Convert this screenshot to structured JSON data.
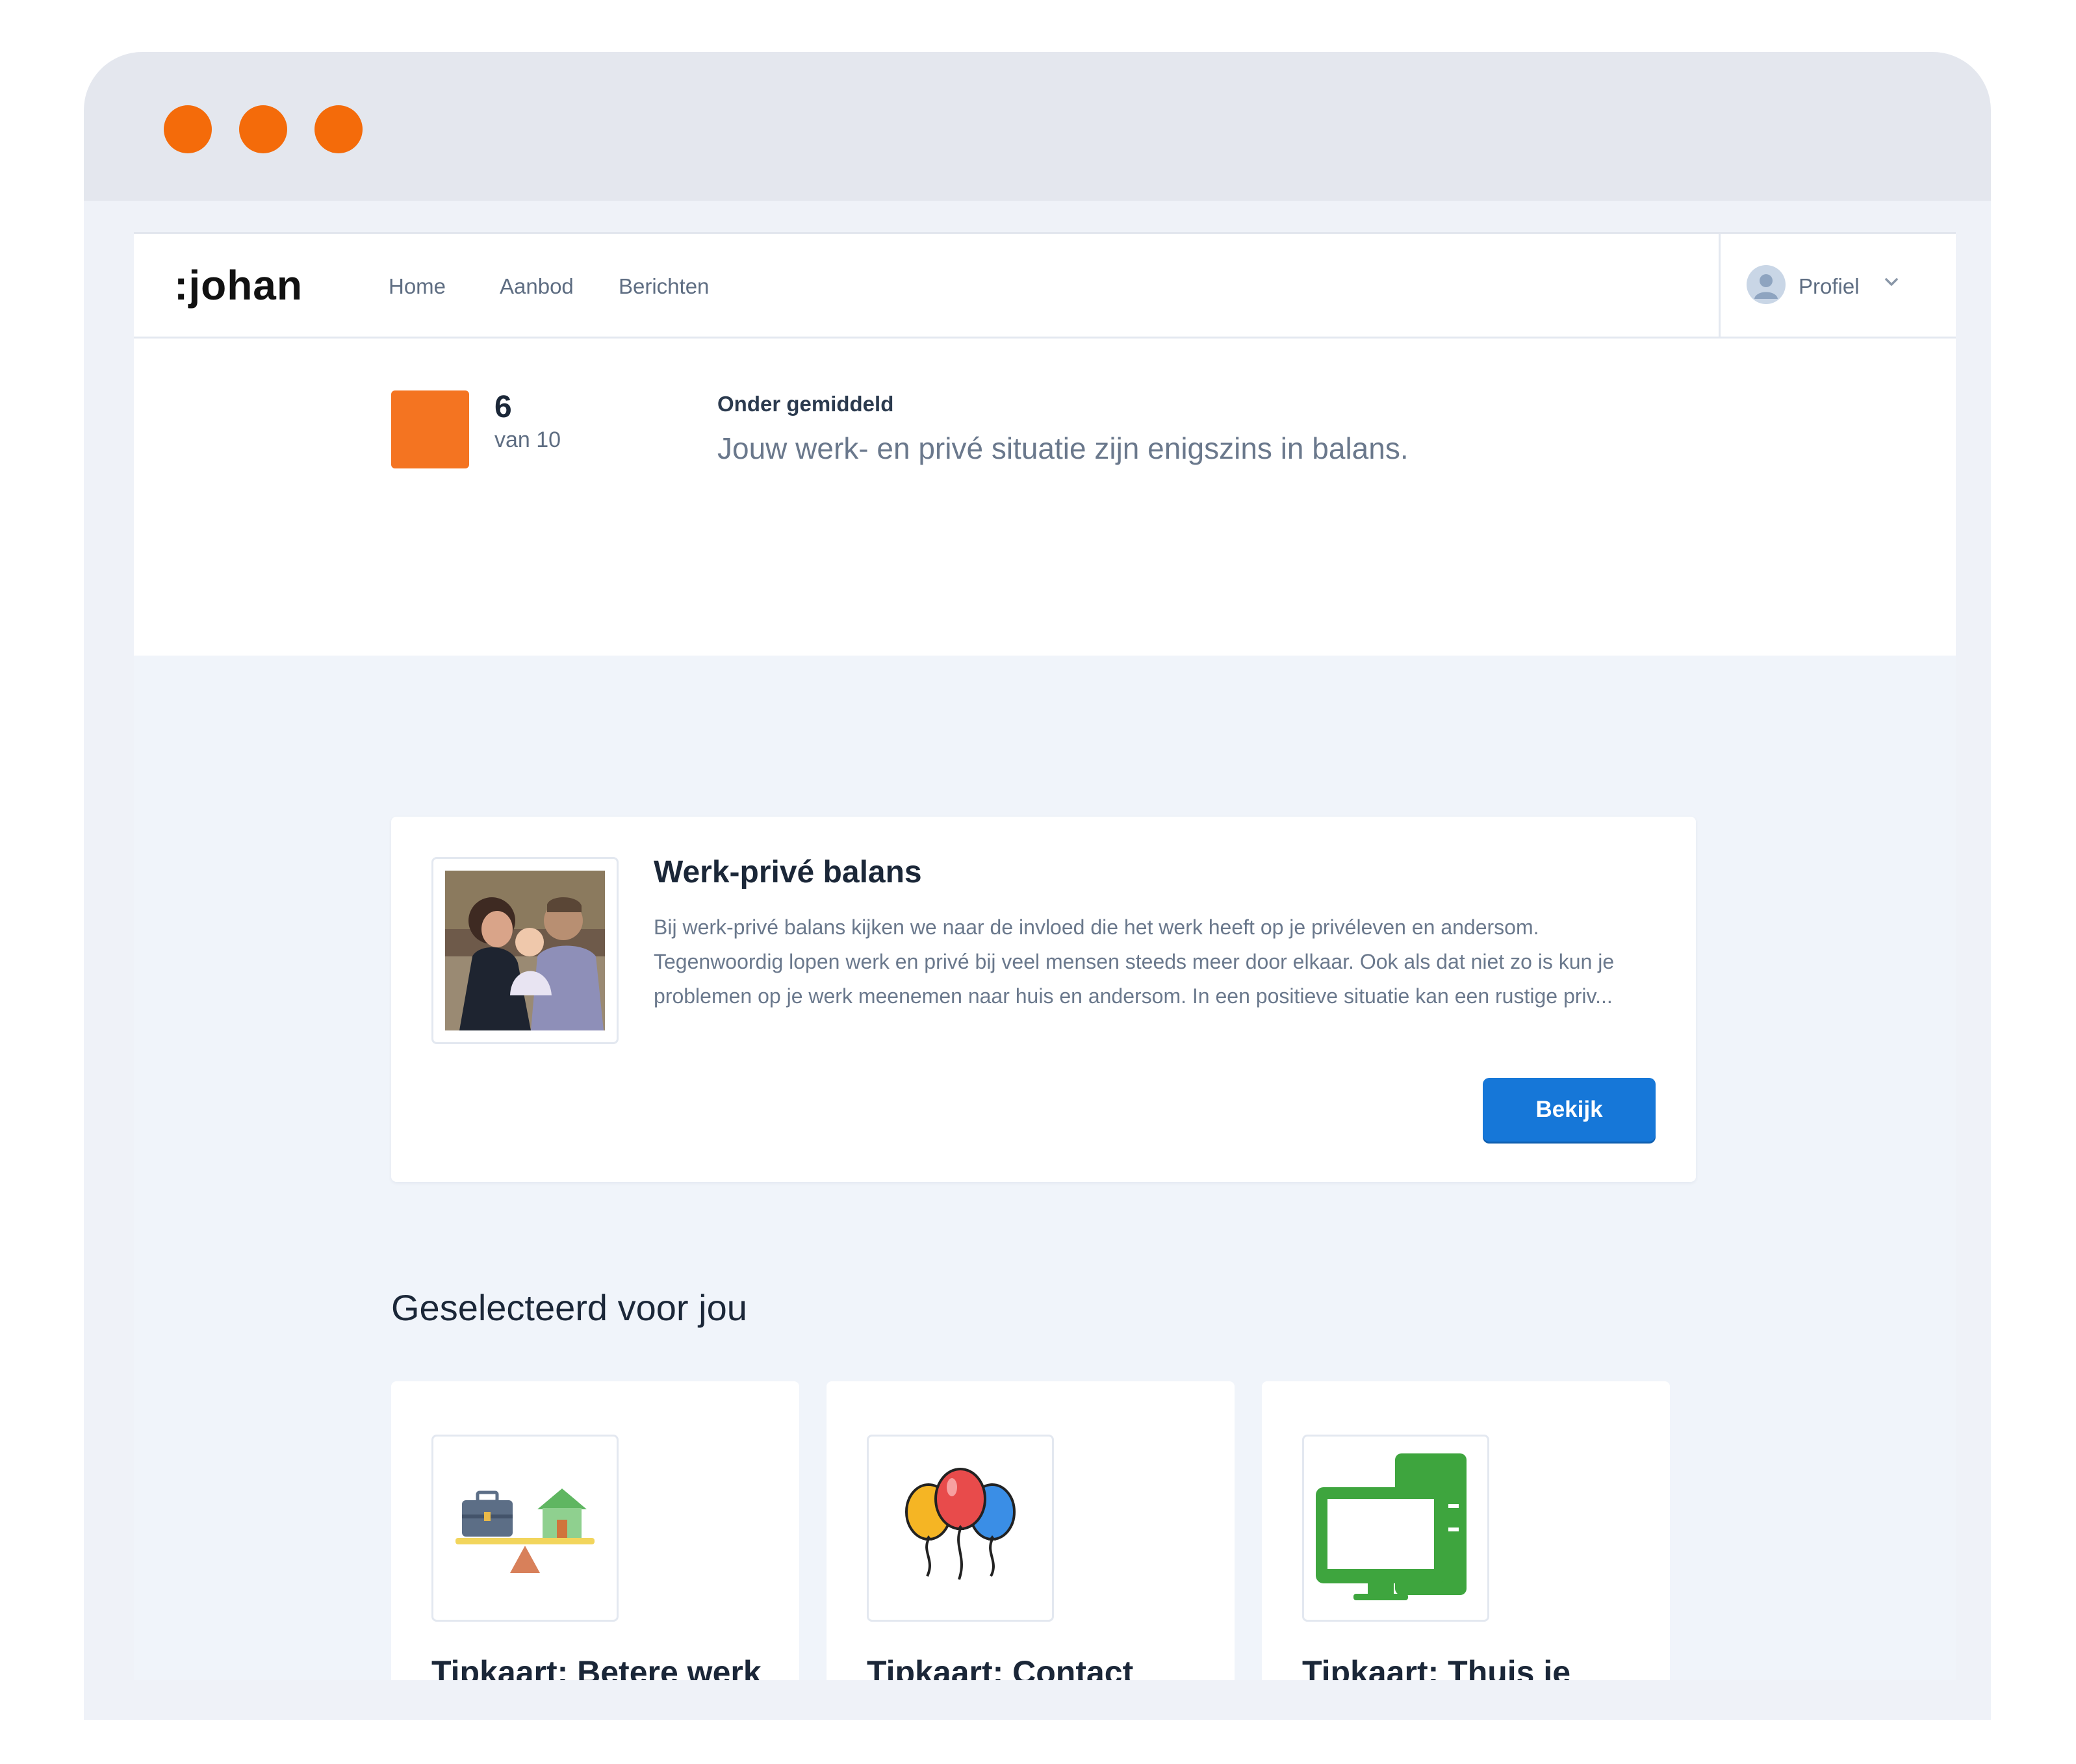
{
  "window": {
    "controls": [
      "close",
      "minimize",
      "maximize"
    ],
    "control_color": "#f46b0a"
  },
  "nav": {
    "logo": ":johan",
    "links": [
      "Home",
      "Aanbod",
      "Berichten"
    ],
    "profile_label": "Profiel",
    "profile_icon": "user-avatar-icon",
    "dropdown_icon": "chevron-down-icon"
  },
  "score": {
    "value": "6",
    "scale": "van 10",
    "color": "#f47421",
    "level": "Onder gemiddeld",
    "description": "Jouw werk- en privé situatie zijn enigszins in balans."
  },
  "feature_card": {
    "title": "Werk-privé balans",
    "body": "Bij werk-privé balans kijken we naar de invloed die het werk heeft op je privéleven en andersom. Tegenwoordig lopen werk en privé bij veel mensen steeds meer door elkaar. Ook als dat niet zo is kun je problemen op je werk meenemen naar huis en andersom. In een positieve situatie kan een rustige priv...",
    "button": "Bekijk",
    "button_color": "#1677d8",
    "image": "family-photo"
  },
  "selected": {
    "heading": "Geselecteerd voor jou",
    "cards": [
      {
        "title": "Tipkaart: Betere werk privé balans",
        "icon": "seesaw-balance-icon"
      },
      {
        "title": "Tipkaart: Contact onderhouden met je",
        "icon": "balloons-icon"
      },
      {
        "title": "Tipkaart: Thuis je werkplek inrichten",
        "icon": "computer-icon"
      }
    ]
  }
}
